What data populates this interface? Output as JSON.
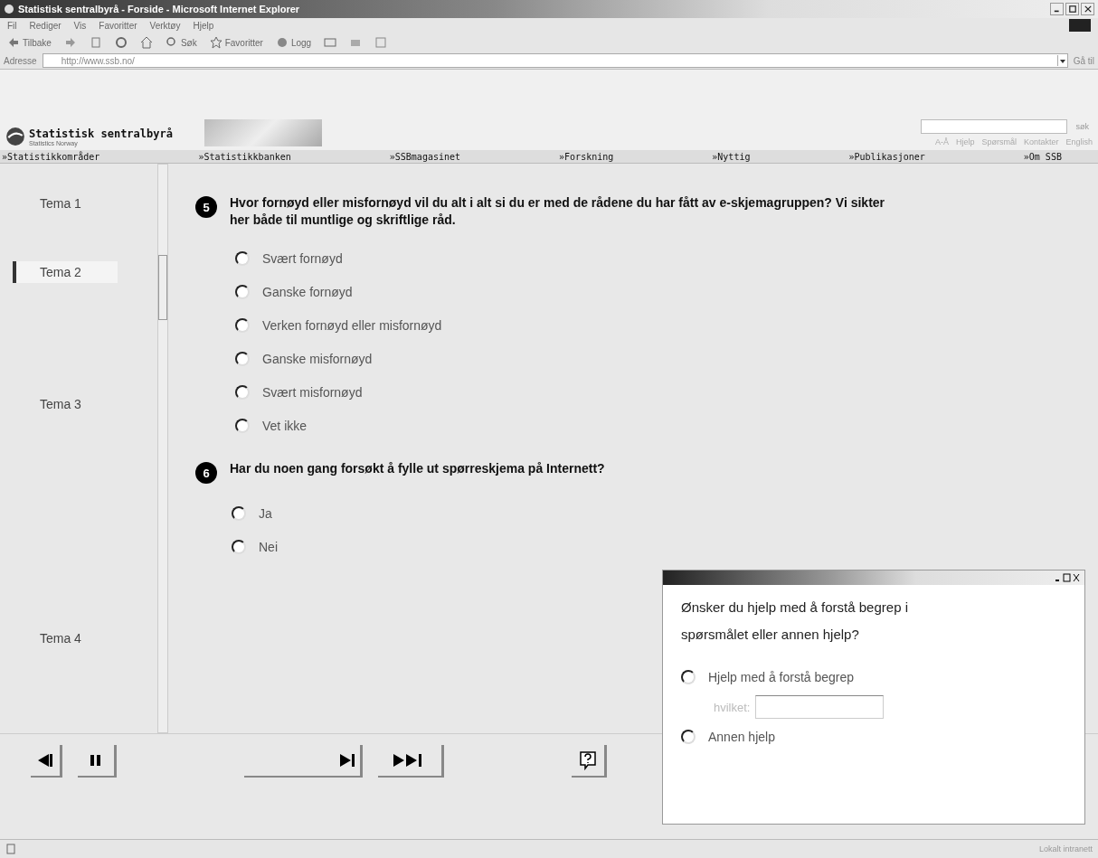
{
  "window": {
    "title": "Statistisk sentralbyrå - Forside - Microsoft Internet Explorer"
  },
  "menu": [
    "Fil",
    "Rediger",
    "Vis",
    "Favoritter",
    "Verktøy",
    "Hjelp"
  ],
  "toolbar": [
    {
      "kind": "back",
      "label": "Tilbake"
    },
    {
      "kind": "forward"
    },
    {
      "kind": "stop"
    },
    {
      "kind": "refresh"
    },
    {
      "kind": "home"
    },
    {
      "kind": "search",
      "label": "Søk"
    },
    {
      "kind": "favorites",
      "label": "Favoritter"
    },
    {
      "kind": "history",
      "label": "Logg"
    },
    {
      "kind": "mail"
    },
    {
      "kind": "print"
    },
    {
      "kind": "edit"
    }
  ],
  "address": {
    "label": "Adresse",
    "value": "http://www.ssb.no/",
    "go": "Gå til"
  },
  "site": {
    "name": "Statistisk sentralbyrå",
    "subtitle": "Statistics Norway",
    "search_button": "søk",
    "links": [
      "A-Å",
      "Hjelp",
      "Spørsmål",
      "Kontakter",
      "English"
    ],
    "nav": [
      "»Statistikkområder",
      "»Statistikkbanken",
      "»SSBmagasinet",
      "»Forskning",
      "»Nyttig",
      "»Publikasjoner",
      "»Om SSB"
    ]
  },
  "sidebar": [
    {
      "label": "Tema 1",
      "selected": false
    },
    {
      "label": "Tema 2",
      "selected": true
    },
    {
      "label": "Tema 3",
      "selected": false
    },
    {
      "label": "Tema 4",
      "selected": false
    }
  ],
  "questions": [
    {
      "number": "5",
      "text": "Hvor fornøyd eller misfornøyd vil du alt i alt si du er med de rådene du har fått av e-skjemagruppen? Vi sikter her både til muntlige og skriftlige råd.",
      "options": [
        {
          "label": "Svært fornøyd",
          "selected": false
        },
        {
          "label": "Ganske fornøyd",
          "selected": false
        },
        {
          "label": "Verken fornøyd eller misfornøyd",
          "selected": false
        },
        {
          "label": "Ganske misfornøyd",
          "selected": false
        },
        {
          "label": "Svært misfornøyd",
          "selected": false
        },
        {
          "label": "Vet ikke",
          "selected": false
        }
      ]
    },
    {
      "number": "6",
      "text": "Har du noen gang forsøkt å fylle ut spørreskjema på Internett?",
      "options": [
        {
          "label": "Ja",
          "selected": false
        },
        {
          "label": "Nei",
          "selected": false
        }
      ]
    }
  ],
  "help_popup": {
    "question": "Ønsker du hjelp med å forstå begrep i spørsmålet eller annen hjelp?",
    "options": [
      {
        "label": "Hjelp med å forstå begrep",
        "selected": false,
        "field_label": "hvilket:"
      },
      {
        "label": "Annen hjelp",
        "selected": false
      }
    ]
  },
  "status_bar": {
    "zone": "Lokalt intranett"
  }
}
